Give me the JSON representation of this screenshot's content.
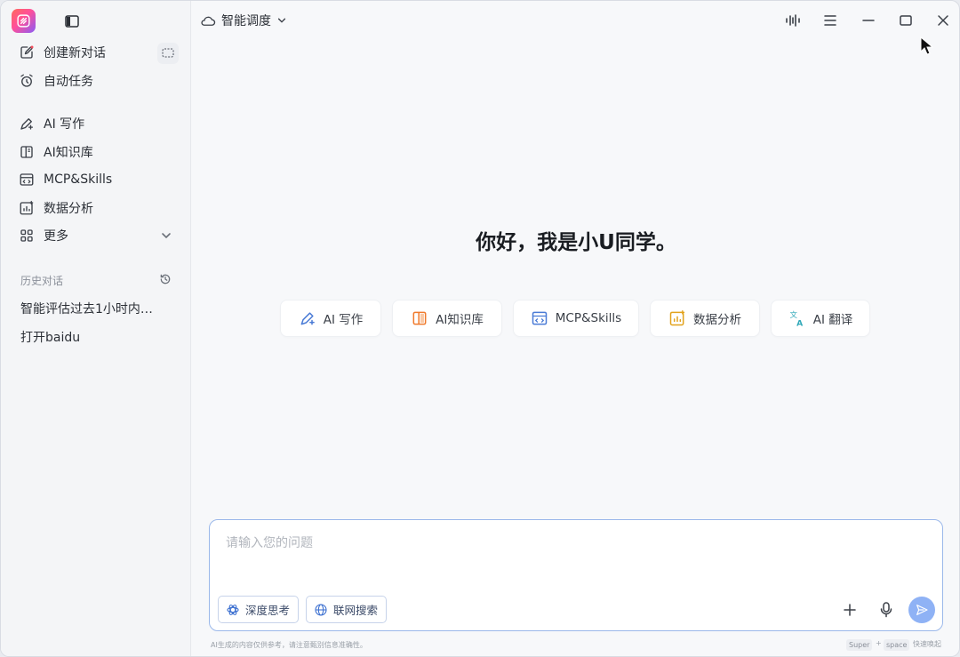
{
  "topbar": {
    "title": "智能调度"
  },
  "sidebar": {
    "new_chat": "创建新对话",
    "auto_tasks": "自动任务",
    "items": [
      {
        "label": "AI 写作",
        "icon": "pen-sparkle-icon"
      },
      {
        "label": "AI知识库",
        "icon": "book-icon"
      },
      {
        "label": "MCP&Skills",
        "icon": "window-code-icon"
      },
      {
        "label": "数据分析",
        "icon": "chart-icon"
      },
      {
        "label": "更多",
        "icon": "grid-icon"
      }
    ],
    "history_label": "历史对话",
    "history": [
      "智能评估过去1小时内…",
      "打开baidu"
    ]
  },
  "main": {
    "greeting": "你好，我是小U同学。",
    "quick_actions": [
      {
        "label": "AI 写作",
        "icon": "pen-sparkle-icon",
        "color": "#4a7bd6"
      },
      {
        "label": "AI知识库",
        "icon": "book-icon",
        "color": "#f07a2c"
      },
      {
        "label": "MCP&Skills",
        "icon": "window-code-icon",
        "color": "#4a7bd6"
      },
      {
        "label": "数据分析",
        "icon": "chart-icon",
        "color": "#e2a21b"
      },
      {
        "label": "AI 翻译",
        "icon": "translate-icon",
        "color": "#2fa8b8"
      }
    ]
  },
  "composer": {
    "placeholder": "请输入您的问题",
    "deep_think": "深度思考",
    "web_search": "联网搜索"
  },
  "footer": {
    "disclaimer": "AI生成的内容仅供参考，请注意甄别信息准确性。",
    "kbd1": "Super",
    "plus": "+",
    "kbd2": "space",
    "shortcut_label": "快速唤起"
  },
  "colors": {
    "accent": "#4a7bd6",
    "send": "#8fb2f5",
    "composer_border": "#9bb8ea"
  }
}
